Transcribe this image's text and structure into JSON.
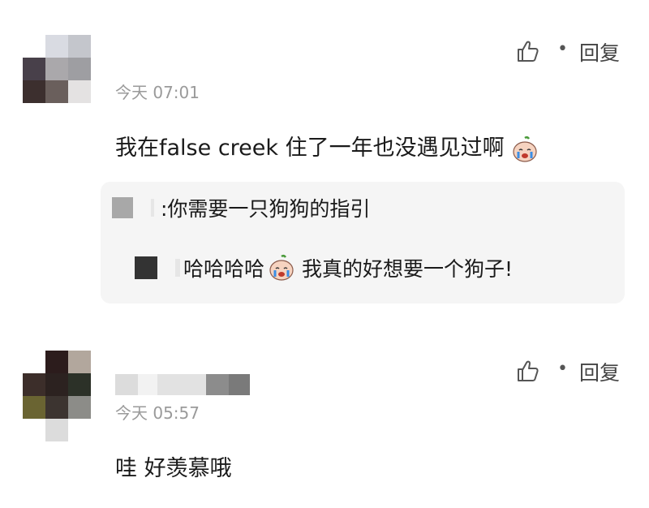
{
  "comments": [
    {
      "time": "今天 07:01",
      "text": "我在false creek 住了一年也没遇见过啊",
      "emoji_icon": "crying-face-icon",
      "reply_label": "回复",
      "thread": [
        {
          "text": ":你需要一只狗狗的指引"
        },
        {
          "text_before": "哈哈哈哈",
          "emoji_icon": "crying-face-icon",
          "text_after": " 我真的好想要一个狗子!"
        }
      ]
    },
    {
      "time": "今天 05:57",
      "text": "哇 好羡慕哦",
      "reply_label": "回复"
    }
  ],
  "colors": {
    "avatar1": [
      "#ffffff",
      "#d9dbe2",
      "#c4c6cc",
      "#48404a",
      "#aaa8ab",
      "#9e9ea2",
      "#3c2f2e",
      "#6a5f5c",
      "#e4e2e2"
    ],
    "avatar2": [
      "#ffffff",
      "#2c1c1c",
      "#b2a79d",
      "#3c2e2a",
      "#2c2220",
      "#2c3128",
      "#6a6432",
      "#3c3430",
      "#8c8c88",
      "#ffffff",
      "#dcdcdc",
      "#ffffff"
    ],
    "name_blur": [
      "#dcdcdc",
      "#f0f0f0",
      "#e0e0e0",
      "#8c8c8c",
      "#7a7a7a"
    ]
  }
}
